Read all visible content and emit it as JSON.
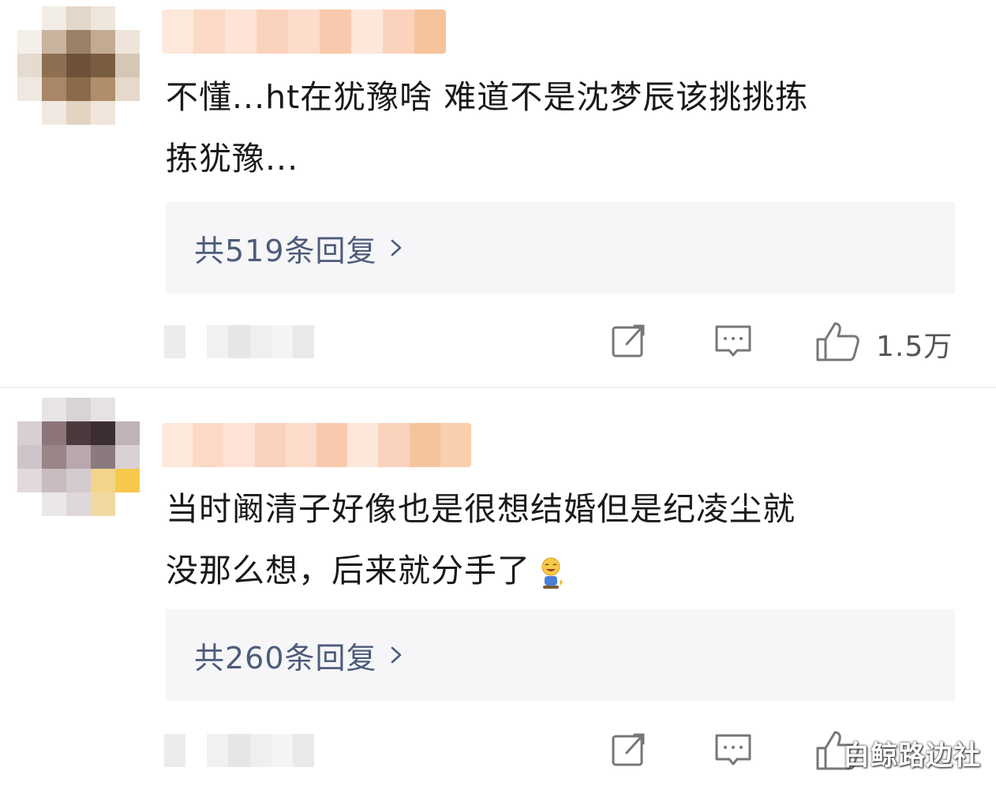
{
  "comments": [
    {
      "text_line1": "不懂...ht在犹豫啥 难道不是沈梦辰该挑挑拣",
      "text_line2": "拣犹豫...",
      "replies_label": "共519条回复",
      "like_count": "1.5万"
    },
    {
      "text_line1": "当时阚清子好像也是很想结婚但是纪凌尘就",
      "text_line2": "没那么想，后来就分手了",
      "replies_label": "共260条回复",
      "like_count": ""
    }
  ],
  "watermark": "白鲸路边社",
  "icons": [
    "share-icon",
    "comment-icon",
    "like-icon",
    "chevron-right-icon",
    "laugh-emoji-icon"
  ],
  "colors": {
    "reply_link": "#4d5c7a",
    "reply_bg": "#f6f6f8",
    "text": "#1a1a1a"
  }
}
